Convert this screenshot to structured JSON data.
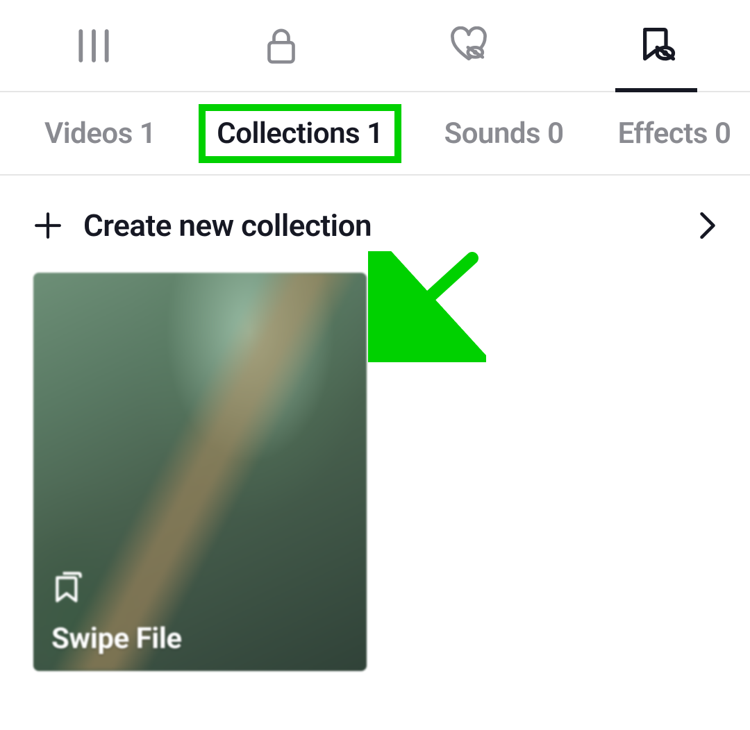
{
  "icon_tabs": {
    "feed": "feed-icon",
    "private": "lock-icon",
    "liked": "heart-hidden-icon",
    "saved": "bookmark-hidden-icon",
    "active_index": 3
  },
  "sub_tabs": [
    {
      "label": "Videos",
      "count": 1,
      "active": false
    },
    {
      "label": "Collections",
      "count": 1,
      "active": true
    },
    {
      "label": "Sounds",
      "count": 0,
      "active": false
    },
    {
      "label": "Effects",
      "count": 0,
      "active": false
    }
  ],
  "create_row": {
    "label": "Create new collection"
  },
  "collections": [
    {
      "title": "Swipe File"
    }
  ],
  "annotation": {
    "highlight_color": "#00d100",
    "arrow_color": "#00d100"
  }
}
